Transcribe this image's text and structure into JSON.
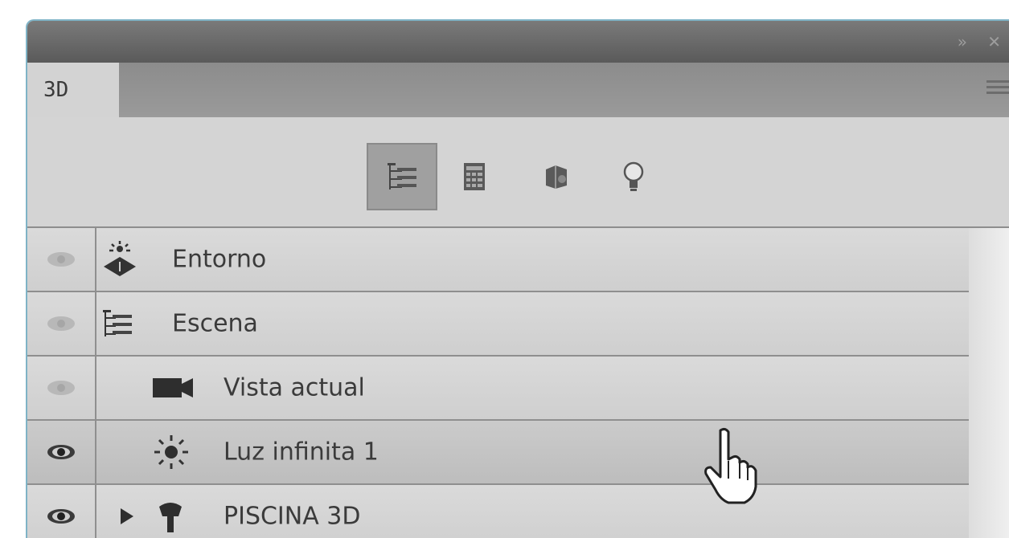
{
  "panel": {
    "tab_label": "3D"
  },
  "toolbar": {
    "buttons": [
      {
        "icon": "scene-filter-icon",
        "active": true
      },
      {
        "icon": "mesh-filter-icon",
        "active": false
      },
      {
        "icon": "material-filter-icon",
        "active": false
      },
      {
        "icon": "light-filter-icon",
        "active": false
      }
    ]
  },
  "layers": [
    {
      "label": "Entorno",
      "icon": "environment-icon",
      "visible": false
    },
    {
      "label": "Escena",
      "icon": "scene-icon",
      "visible": false
    },
    {
      "label": "Vista actual",
      "icon": "camera-icon",
      "visible": false
    },
    {
      "label": "Luz infinita 1",
      "icon": "sun-light-icon",
      "visible": true
    },
    {
      "label": "PISCINA 3D",
      "icon": "mesh-icon",
      "visible": true
    }
  ],
  "colors": {
    "panel_bg": "#d2d2d2",
    "titlebar": "#6a6a6a",
    "border_accent": "#7fb3c6"
  }
}
